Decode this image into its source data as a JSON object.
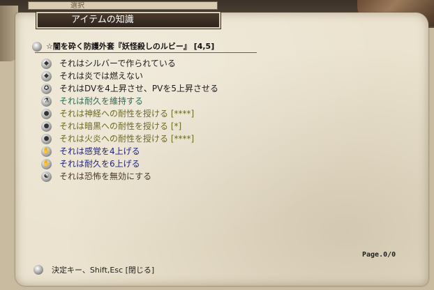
{
  "window": {
    "title": "アイテムの知識",
    "background_title_fragment": "選択"
  },
  "item": {
    "name": "☆闇を砕く防護外套『妖怪殺しのルビー』 [4,5]"
  },
  "properties": [
    {
      "text": "それはシルバーで作られている",
      "color": "#1c1c1c",
      "icon": "diamond-icon"
    },
    {
      "text": "それは炎では燃えない",
      "color": "#1c1c1c",
      "icon": "diamond-icon"
    },
    {
      "text": "それはDVを4上昇させ、PVを5上昇させる",
      "color": "#1c1c1c",
      "icon": "shield-icon"
    },
    {
      "text": "それは耐久を維持する",
      "color": "#2d6e54",
      "icon": "flask-icon"
    },
    {
      "text": "それは神経への耐性を授ける [****]",
      "color": "#6e6a22",
      "icon": "orb-icon"
    },
    {
      "text": "それは暗黒への耐性を授ける [*]",
      "color": "#6e6a22",
      "icon": "orb-icon"
    },
    {
      "text": "それは火炎への耐性を授ける [****]",
      "color": "#6e6a22",
      "icon": "orb-icon"
    },
    {
      "text": "それは感覚を4上げる",
      "color": "#22267a",
      "icon": "hand-icon"
    },
    {
      "text": "それは耐久を6上げる",
      "color": "#22267a",
      "icon": "hand-icon"
    },
    {
      "text": "それは恐怖を無効にする",
      "color": "#4a3b26",
      "icon": "spirit-icon"
    }
  ],
  "pagination": {
    "label": "Page.0/0"
  },
  "footer": {
    "hint": "決定キー、Shift,Esc [閉じる]"
  }
}
